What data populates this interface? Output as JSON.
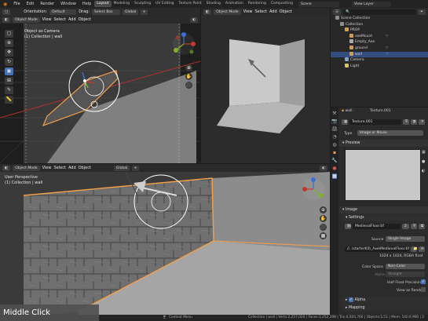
{
  "topbar": {
    "menus": [
      "File",
      "Edit",
      "Render",
      "Window",
      "Help"
    ],
    "workspaces": [
      "Layout",
      "Modeling",
      "Sculpting",
      "UV Editing",
      "Texture Paint",
      "Shading",
      "Animation",
      "Rendering",
      "Compositing"
    ],
    "active_workspace": "Layout",
    "scene": "Scene",
    "view_layer": "View Layer"
  },
  "tool_header": {
    "orientation_label": "Orientation:",
    "orientation_value": "Default",
    "drag_label": "Drag:",
    "drag_value": "Select Box",
    "transform_value": "Global"
  },
  "vp_top_left": {
    "mode": "Object Mode",
    "menus": [
      "View",
      "Select",
      "Add",
      "Object"
    ],
    "overlay_title": "Object as Camera",
    "overlay_sub": "(1) Collection | wall"
  },
  "vp_top_right": {
    "mode": "Object Mode",
    "menus": [
      "View",
      "Select",
      "Add",
      "Object"
    ]
  },
  "vp_bottom": {
    "mode": "Object Mode",
    "menus": [
      "View",
      "Select",
      "Add",
      "Object"
    ],
    "transform_value": "Global",
    "overlay_title": "User Perspective",
    "overlay_sub": "(1) Collection | wall"
  },
  "outliner": {
    "root": "Scene Collection",
    "rows": [
      {
        "label": "Collection",
        "depth": 1,
        "color": "#8f8f8f"
      },
      {
        "label": "PROP",
        "depth": 2,
        "color": "#d99b4a"
      },
      {
        "label": "axeMount",
        "depth": 3,
        "color": "#d99b4a"
      },
      {
        "label": "Empty_Axe",
        "depth": 3,
        "color": "#aaaaaa"
      },
      {
        "label": "ground",
        "depth": 3,
        "color": "#d99b4a"
      },
      {
        "label": "wall",
        "depth": 3,
        "color": "#d99b4a"
      },
      {
        "label": "Camera",
        "depth": 2,
        "color": "#7fa3c9"
      },
      {
        "label": "Light",
        "depth": 2,
        "color": "#dcc45a"
      }
    ],
    "selected": "wall"
  },
  "properties": {
    "breadcrumb_object": "wall",
    "breadcrumb_texture": "Texture.001",
    "texture_name": "Texture.001",
    "type_label": "Type",
    "type_value": "Image or Movie",
    "preview_panel": "Preview",
    "image_panel": "Image",
    "settings_panel": "Settings",
    "image_name": "MedievalFloor.tif",
    "image_users": "2",
    "source_label": "Source",
    "source_value": "Single Image",
    "filepath": "//..\\starterKit\\_Axe\\MedievalFloor.tif",
    "resolution": "1024 x 1024,  RGBA float",
    "colorspace_label": "Color Space",
    "colorspace_value": "Non-Color",
    "alpha_label": "Alpha",
    "alpha_value": "Straight",
    "half_float_label": "Half Float Precision",
    "view_as_render_label": "View as Render",
    "alpha_section": "Alpha",
    "mapping_section": "Mapping"
  },
  "statusbar": {
    "context_menu": "Context Menu",
    "stats": "Collection | wall | Verts:2,257,020 | Faces:2,252,398 | Tris:4,504,760 | Objects:1/11 | Mem: 540.6 MiB | 2"
  },
  "keypress_overlay": "Middle Click",
  "colors": {
    "accent_blue": "#4772b3",
    "selection_orange": "#f5a04a",
    "x_axis": "#c0392b",
    "y_axis": "#7fb32e",
    "z_axis": "#3b6fd1"
  }
}
